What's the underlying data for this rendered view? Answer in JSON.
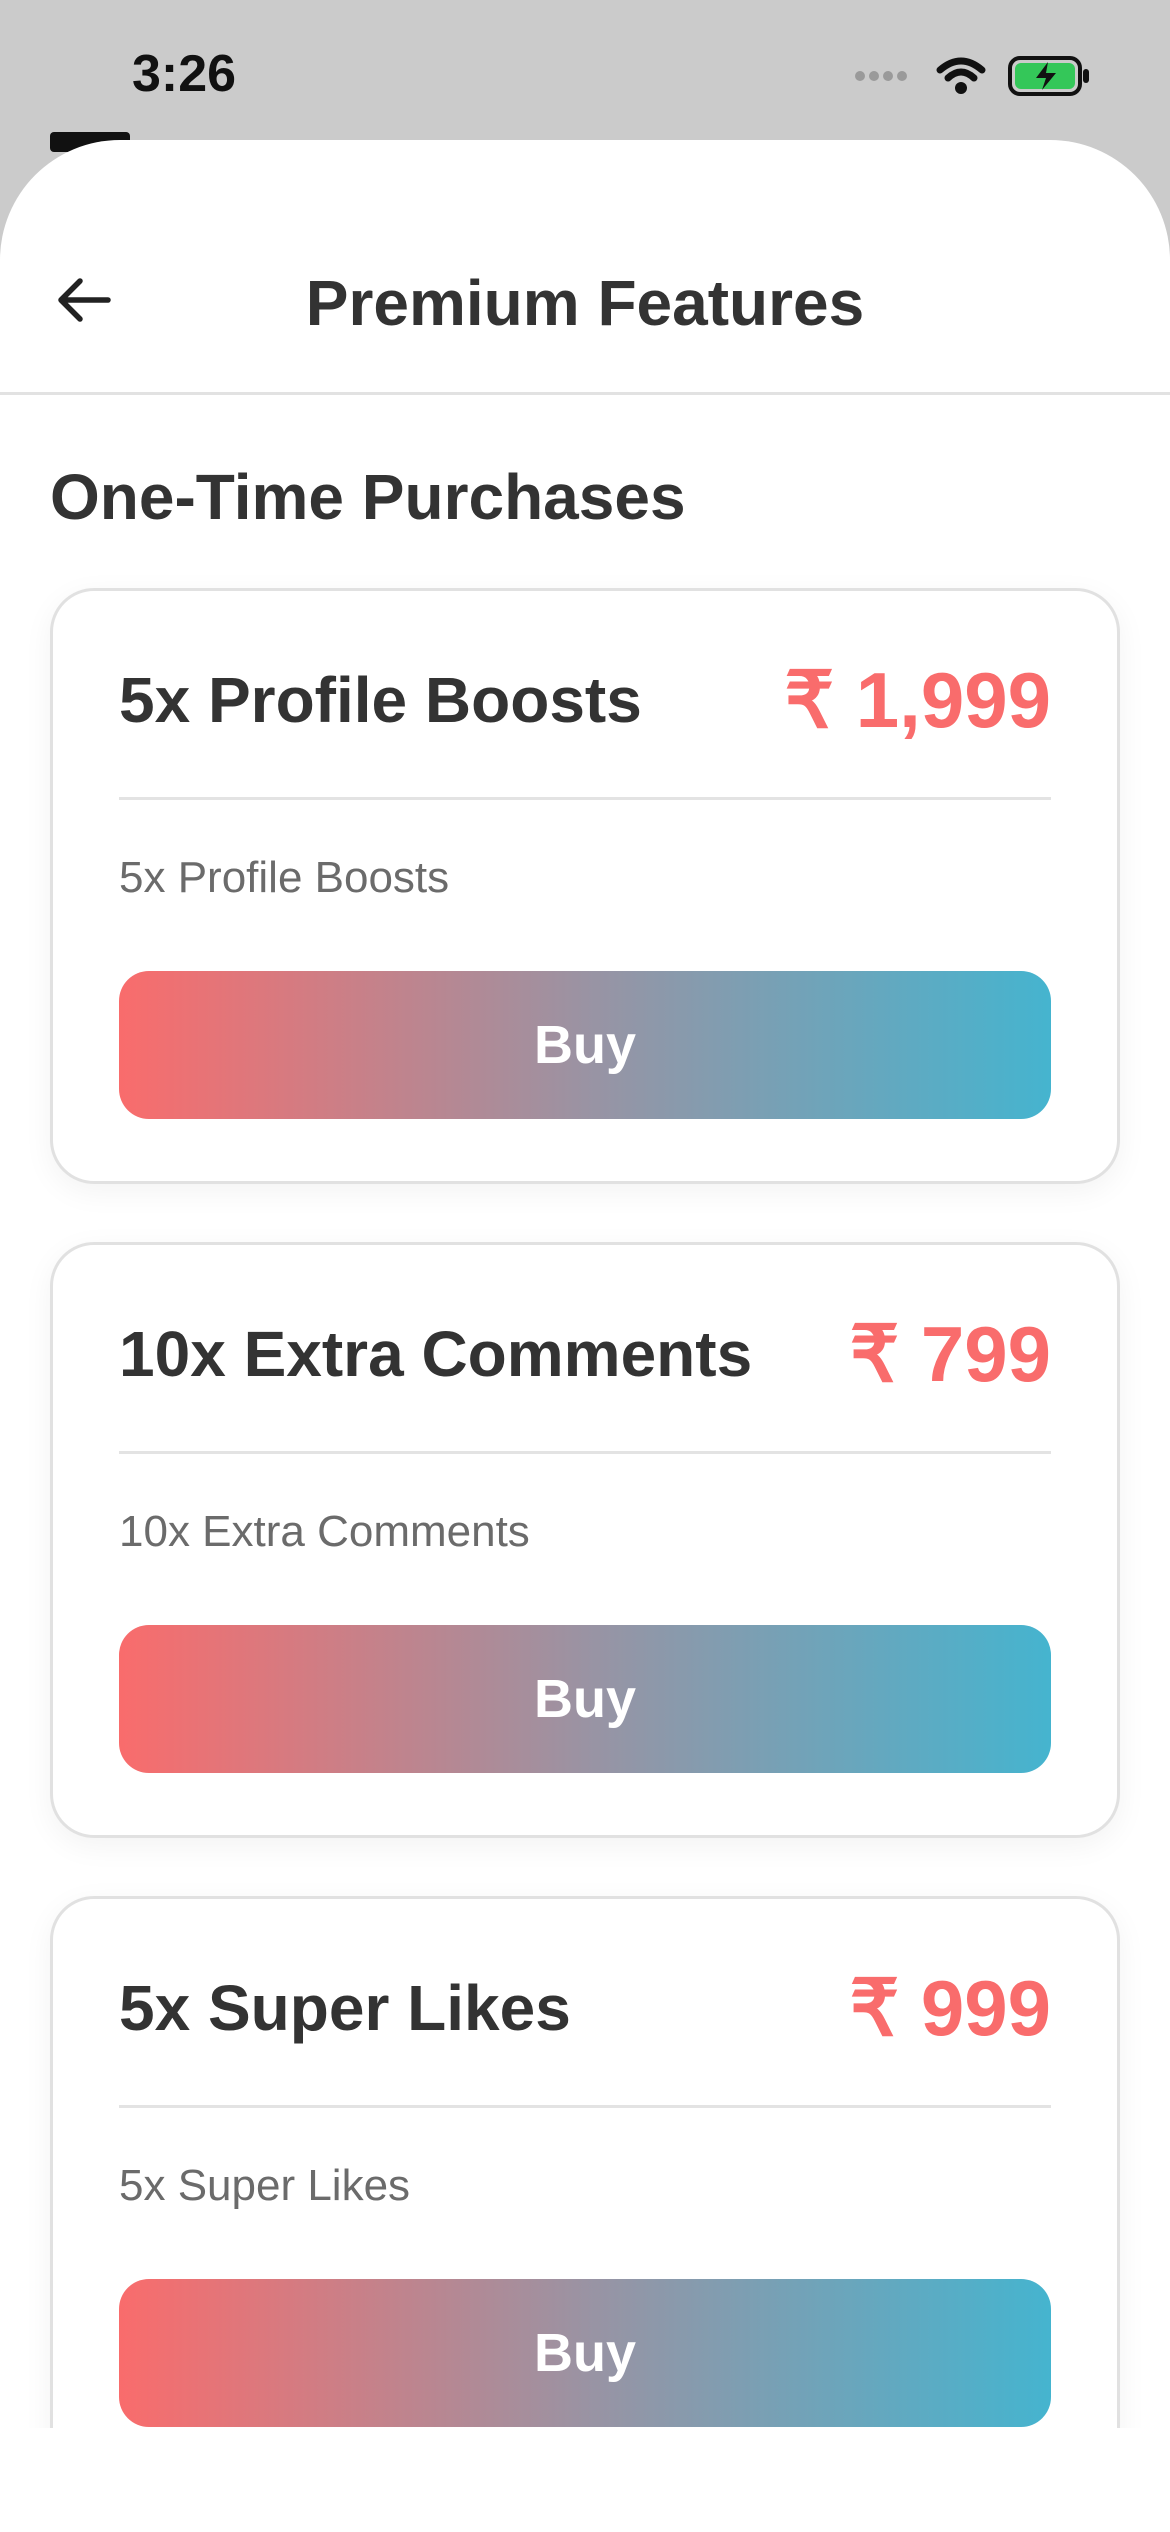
{
  "status_bar": {
    "time": "3:26"
  },
  "header": {
    "title": "Premium Features",
    "back_icon": "arrow-left-icon"
  },
  "section": {
    "title": "One-Time Purchases"
  },
  "products": [
    {
      "name": "5x Profile Boosts",
      "price": "₹ 1,999",
      "description": "5x Profile Boosts",
      "buy_label": "Buy"
    },
    {
      "name": "10x Extra Comments",
      "price": "₹ 799",
      "description": "10x Extra Comments",
      "buy_label": "Buy"
    },
    {
      "name": "5x Super Likes",
      "price": "₹ 999",
      "description": "5x Super Likes",
      "buy_label": "Buy"
    }
  ],
  "colors": {
    "price": "#f96c6c",
    "gradient_start": "#f96c6c",
    "gradient_end": "#45b4cf",
    "battery": "#34c759"
  }
}
